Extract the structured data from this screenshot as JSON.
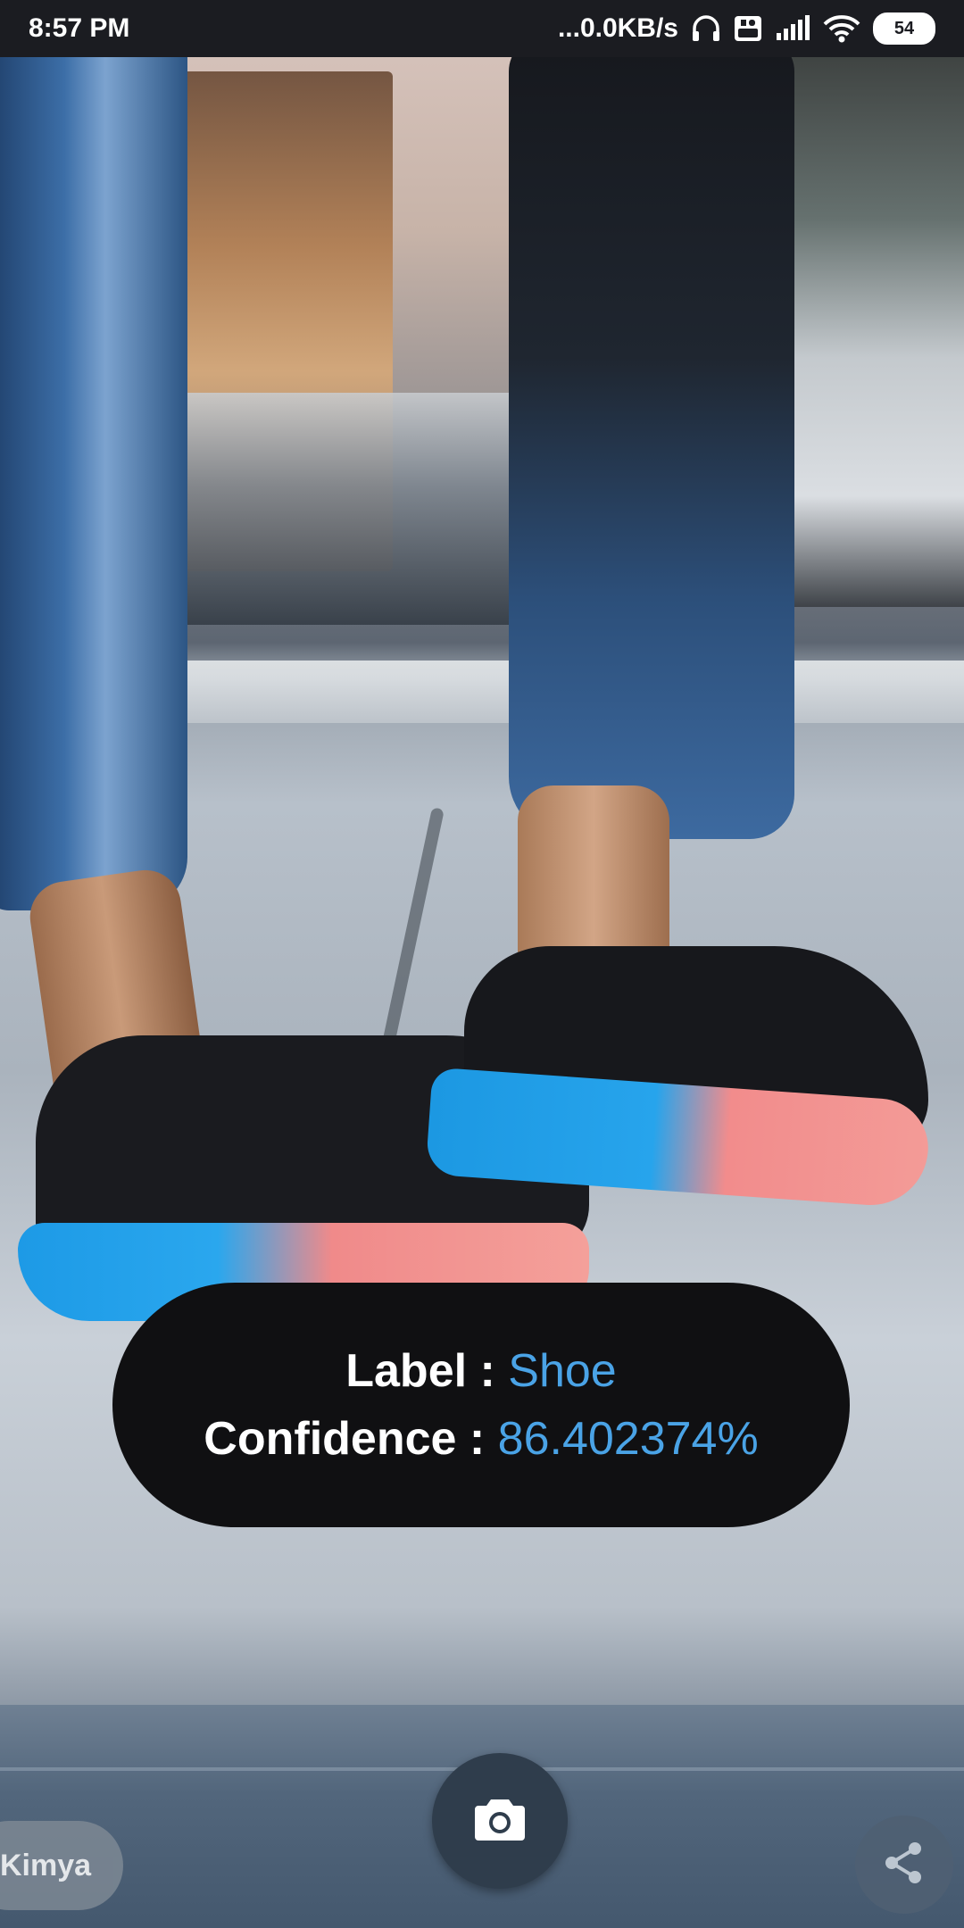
{
  "status_bar": {
    "time": "8:57 PM",
    "network_speed": "...0.0KB/s",
    "battery_level": "54",
    "icons": [
      "headphones-icon",
      "volte-icon",
      "signal-icon",
      "wifi-icon",
      "battery-icon"
    ]
  },
  "result": {
    "label_key": "Label :",
    "label_value": "Shoe",
    "confidence_key": "Confidence :",
    "confidence_value": "86.402374%"
  },
  "controls": {
    "camera_icon": "camera-icon",
    "chip_label": "Kimya",
    "share_icon": "share-icon"
  },
  "colors": {
    "pill_background": "#101012",
    "value_accent": "#4aa3e6",
    "status_bar": "#1b1c21"
  }
}
